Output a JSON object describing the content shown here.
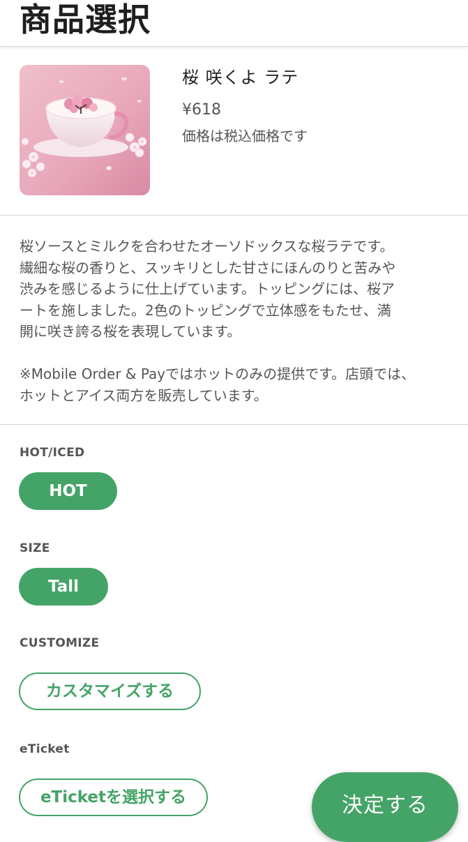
{
  "header": {
    "title": "商品選択"
  },
  "product": {
    "name": "桜 咲くよ ラテ",
    "price": "¥618",
    "tax_note": "価格は税込価格です",
    "image_icon": "sakura-latte-image"
  },
  "description": {
    "paragraph1_lines": [
      "桜ソースとミルクを合わせたオーソドックスな桜ラテです。",
      "繊細な桜の香りと、スッキリとした甘さにほんのりと苦みや",
      "渋みを感じるように仕上げています。トッピングには、桜ア",
      "ートを施しました。2色のトッピングで立体感をもたせ、満",
      "開に咲き誇る桜を表現しています。"
    ],
    "paragraph2_lines": [
      "※Mobile Order & Payではホットのみの提供です。店頭では、",
      "ホットとアイス両方を販売しています。"
    ]
  },
  "options": {
    "hot_iced": {
      "label": "HOT/ICED",
      "selected": "HOT"
    },
    "size": {
      "label": "SIZE",
      "selected": "Tall"
    },
    "customize": {
      "label": "CUSTOMIZE",
      "button": "カスタマイズする"
    },
    "eticket": {
      "label": "eTicket",
      "button": "eTicketを選択する"
    }
  },
  "actions": {
    "confirm": "決定する"
  },
  "colors": {
    "accent": "#44a467",
    "text_primary": "#1e1e1e",
    "text_secondary": "#555555",
    "divider": "#d4d4d4"
  }
}
